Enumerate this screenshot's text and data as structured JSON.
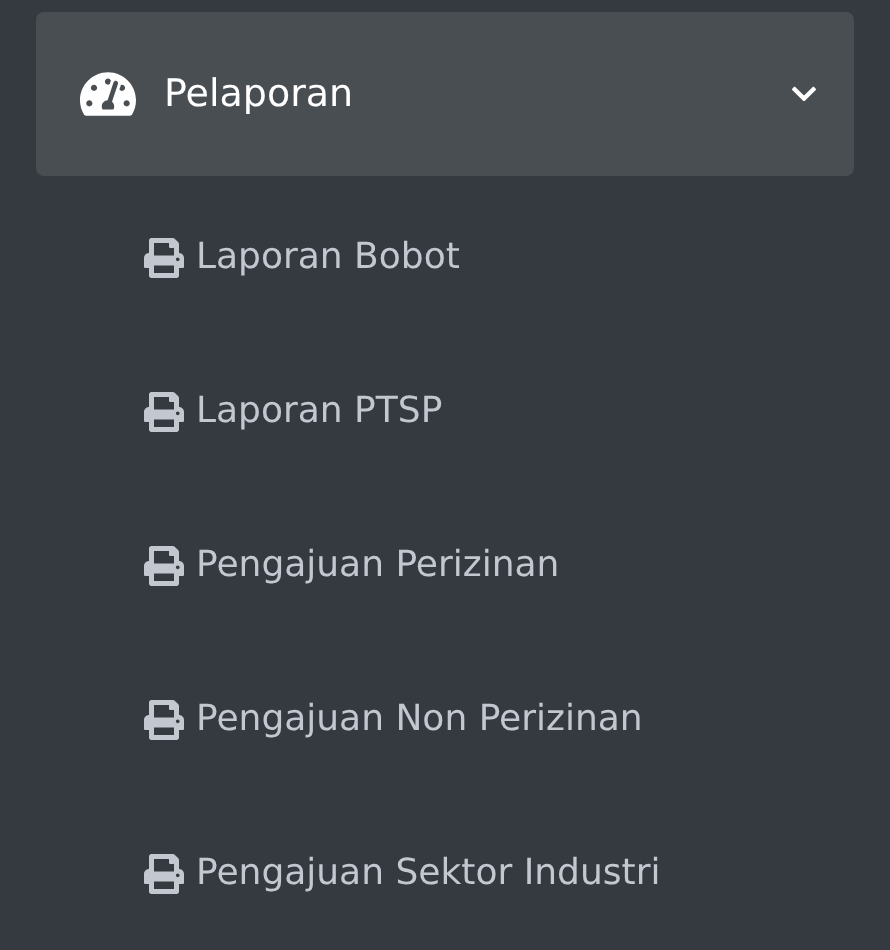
{
  "menu": {
    "label": "Pelaporan",
    "expanded": true,
    "items": [
      {
        "label": "Laporan Bobot"
      },
      {
        "label": "Laporan PTSP"
      },
      {
        "label": "Pengajuan Perizinan"
      },
      {
        "label": "Pengajuan Non Perizinan"
      },
      {
        "label": "Pengajuan Sektor Industri"
      }
    ]
  }
}
